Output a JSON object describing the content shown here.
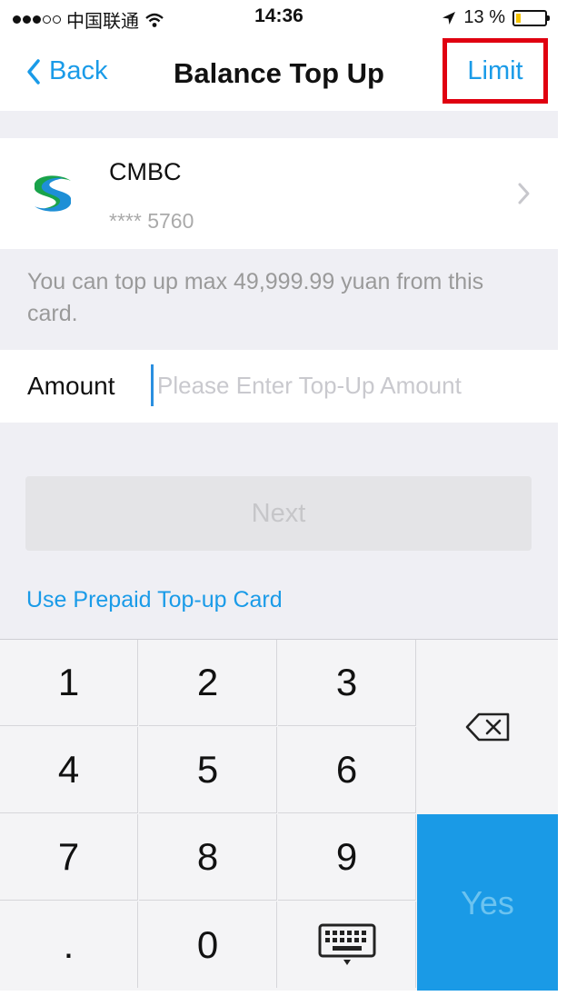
{
  "status_bar": {
    "carrier": "中国联通",
    "time": "14:36",
    "battery": "13 %",
    "signal_bars_filled": 3,
    "signal_bars_total": 5
  },
  "nav": {
    "back_label": "Back",
    "title": "Balance Top Up",
    "limit_label": "Limit"
  },
  "card": {
    "bank_name": "CMBC",
    "card_number": "**** 5760"
  },
  "hint": "You can top up max 49,999.99 yuan from this card.",
  "amount": {
    "label": "Amount",
    "placeholder": "Please Enter Top-Up Amount",
    "value": ""
  },
  "next_label": "Next",
  "prepaid_link": "Use Prepaid Top-up Card",
  "keypad": {
    "keys": [
      "1",
      "2",
      "3",
      "4",
      "5",
      "6",
      "7",
      "8",
      "9",
      ".",
      "0"
    ],
    "confirm_label": "Yes"
  },
  "colors": {
    "accent": "#1a9be8",
    "highlight_box": "#e00010",
    "battery_fill": "#f5c400"
  }
}
